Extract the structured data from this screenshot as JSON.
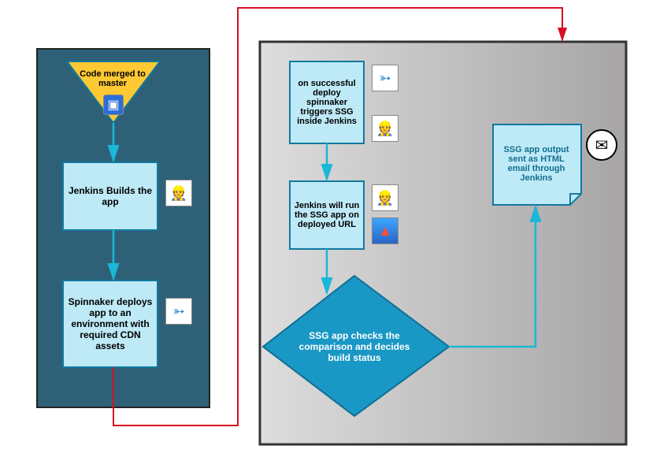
{
  "nodes": {
    "merge": {
      "text": "Code merged to master"
    },
    "build": {
      "text": "Jenkins Builds the app"
    },
    "deploy": {
      "text": "Spinnaker deploys app to an environment with required CDN assets"
    },
    "trigger": {
      "text": "on successful deploy spinnaker triggers SSG inside Jenkins"
    },
    "run": {
      "text": "Jenkins will run the SSG app on deployed URL"
    },
    "check": {
      "text": "SSG app checks the comparison and decides build status"
    },
    "email": {
      "text": "SSG app output sent as HTML email through Jenkins"
    }
  },
  "colors": {
    "leftPanel": "#2e6178",
    "rightPanel_a": "#dedddd",
    "rightPanel_b": "#a7a5a5",
    "blockFill": "#bee9f6",
    "blockStroke": "#12799e",
    "triangleFill": "#ffc933",
    "triangleStroke": "#12799e",
    "diamondFill": "#1998c5",
    "diamondStroke": "#0f6f92",
    "flowCyan": "#1ab7d8",
    "connectorRed": "#d61022"
  }
}
